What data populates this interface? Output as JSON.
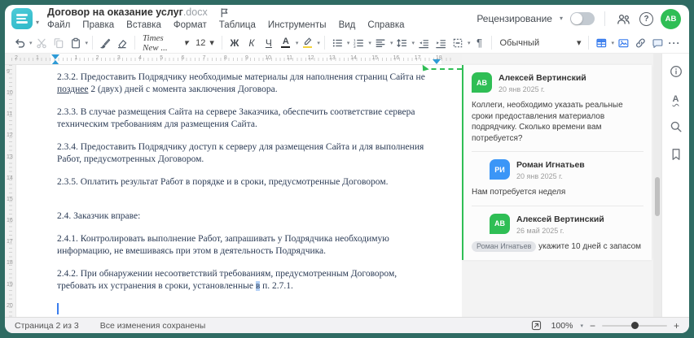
{
  "app": {
    "title": "Договор на оказание услуг",
    "ext": ".docx",
    "menus": [
      "Файл",
      "Правка",
      "Вставка",
      "Формат",
      "Таблица",
      "Инструменты",
      "Вид",
      "Справка"
    ],
    "review_label": "Рецензирование",
    "review_toggle_on": false,
    "avatar_initials": "АВ"
  },
  "icons": {
    "caret": "▾",
    "help": "?",
    "more": "···",
    "paragraph": "¶",
    "spell": "А"
  },
  "toolbar": {
    "font": "Times New ...",
    "size": "12",
    "bold": "Ж",
    "italic": "К",
    "underline": "Ч",
    "font_color": "А",
    "style": "Обычный"
  },
  "ruler": {
    "margin_numbers": [
      "2",
      "1"
    ],
    "page_numbers": [
      "1",
      "2",
      "3",
      "4",
      "5",
      "6",
      "7",
      "8",
      "9",
      "10",
      "11",
      "12",
      "13",
      "14",
      "15",
      "16",
      "17",
      "18"
    ],
    "v_numbers": [
      "9",
      "10",
      "11",
      "12",
      "13",
      "14",
      "15",
      "16",
      "17",
      "18",
      "19",
      "20"
    ]
  },
  "doc": {
    "paragraphs": [
      {
        "segments": [
          {
            "t": "2.3.2. Предоставить Подрядчику необходимые материалы для наполнения страниц Сайта не "
          },
          {
            "t": "позднее",
            "u": true
          },
          {
            "t": " 2 (двух) дней с момента заключения Договора."
          }
        ]
      },
      {
        "segments": [
          {
            "t": "2.3.3. В случае размещения Сайта на сервере Заказчика, обеспечить соответствие сервера техническим требованиям для размещения Сайта."
          }
        ]
      },
      {
        "segments": [
          {
            "t": "2.3.4. Предоставить Подрядчику доступ к серверу для размещения Сайта и для выполнения Работ, предусмотренных Договором."
          }
        ]
      },
      {
        "segments": [
          {
            "t": "2.3.5. Оплатить результат Работ в порядке и в сроки, предусмотренные Договором."
          }
        ]
      },
      {
        "segments": [
          {
            "t": "2.4. Заказчик вправе:"
          }
        ],
        "gap_before": true
      },
      {
        "segments": [
          {
            "t": "2.4.1. Контролировать выполнение Работ, запрашивать у Подрядчика необходимую информацию, не вмешиваясь при этом в деятельность Подрядчика."
          }
        ]
      },
      {
        "segments": [
          {
            "t": "2.4.2. При обнаружении несоответствий требованиям, предусмотренным Договором, требовать их устранения в сроки, установленные "
          },
          {
            "t": "в",
            "hl": true
          },
          {
            "t": " п. 2.7.1."
          }
        ]
      }
    ]
  },
  "comments": {
    "thread": [
      {
        "initials": "АВ",
        "color": "green",
        "author": "Алексей Вертинский",
        "date": "20 янв 2025 г.",
        "text": "Коллеги, необходимо указать реальные сроки предоставления материалов подрядчику. Сколько времени вам потребуется?"
      },
      {
        "initials": "РИ",
        "color": "blue",
        "author": "Роман Игнатьев",
        "date": "20 янв 2025 г.",
        "text": "Нам потребуется неделя"
      },
      {
        "initials": "АВ",
        "color": "green",
        "author": "Алексей Вертинский",
        "date": "26 май 2025 г.",
        "mention": "Роман Игнатьев",
        "text": " укажите 10 дней с запасом"
      }
    ]
  },
  "statusbar": {
    "page": "Страница 2 из 3",
    "saved": "Все изменения сохранены",
    "zoom": "100%",
    "minus": "−",
    "plus": "+"
  },
  "colors": {
    "frame": "#2f6b63",
    "accent_green": "#2fbe55",
    "accent_blue": "#3a7ded",
    "avatar_blue": "#3b96f7",
    "doc_text": "#2b3b55"
  }
}
